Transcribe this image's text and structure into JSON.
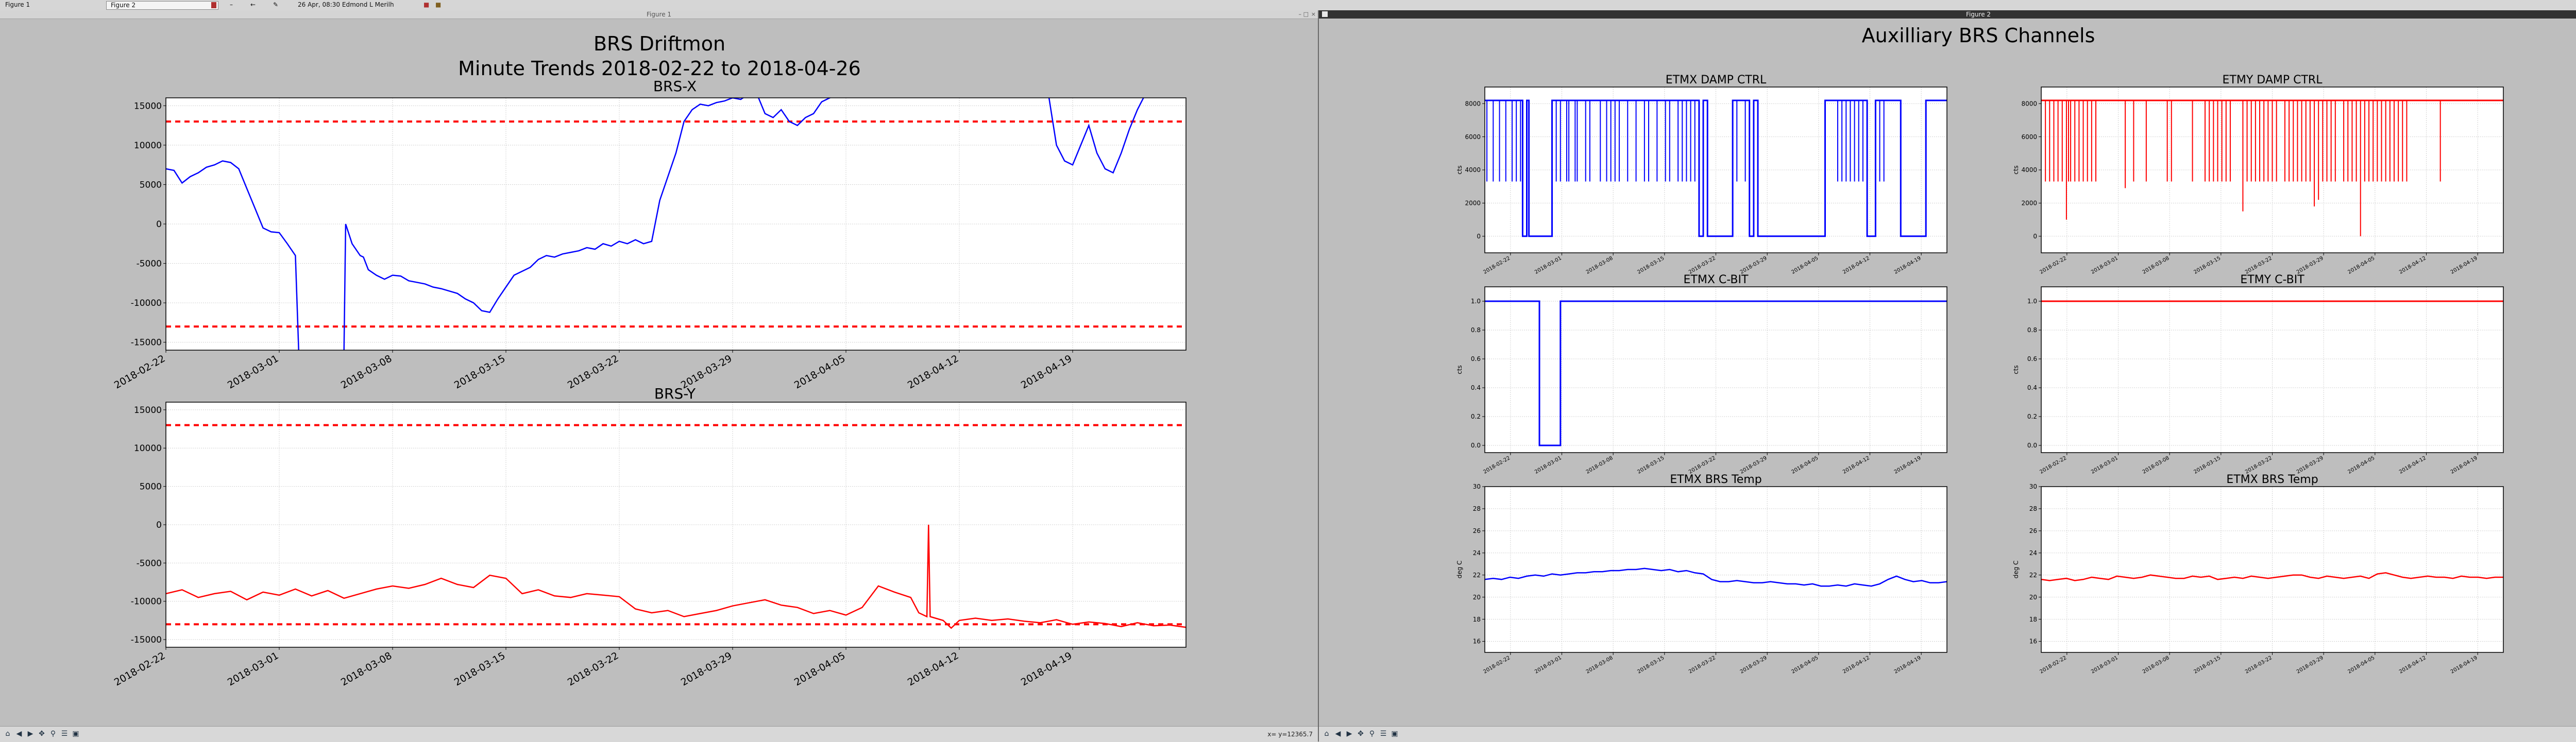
{
  "taskbar": {
    "window1_label": "Figure 1",
    "window2_label": "Figure 2",
    "clock_user": "26 Apr, 08:30  Edmond L Merilh"
  },
  "window1": {
    "title": "Figure 1",
    "suptitle_line1": "BRS Driftmon",
    "suptitle_line2": "Minute Trends 2018-02-22  to 2018-04-26",
    "coords_readout": "x=  y=12365.7"
  },
  "window2": {
    "title": "Figure 2",
    "suptitle": "Auxilliary BRS Channels"
  },
  "colors": {
    "blue": "#0000ff",
    "red": "#ff0000",
    "threshold": "#ff0000",
    "grid": "#d0d0d0"
  },
  "chart_data": [
    {
      "type": "line",
      "title": "BRS-X",
      "color": "#0000ff",
      "xlabel": "",
      "ylabel": "",
      "xlim": [
        0,
        63
      ],
      "ylim": [
        -16000,
        16000
      ],
      "xticks": [
        0,
        7,
        14,
        21,
        28,
        35,
        42,
        49,
        56
      ],
      "xticklabels": [
        "2018-02-22",
        "2018-03-01",
        "2018-03-08",
        "2018-03-15",
        "2018-03-22",
        "2018-03-29",
        "2018-04-05",
        "2018-04-12",
        "2018-04-19"
      ],
      "yticks": [
        -15000,
        -10000,
        -5000,
        0,
        5000,
        10000,
        15000
      ],
      "thresholds": [
        13000,
        -13000
      ],
      "segments": [
        [
          [
            0,
            7000
          ],
          [
            0.5,
            6800
          ],
          [
            1,
            5200
          ],
          [
            1.5,
            6000
          ],
          [
            2,
            6500
          ],
          [
            2.5,
            7200
          ],
          [
            3,
            7500
          ],
          [
            3.5,
            8000
          ],
          [
            4,
            7800
          ],
          [
            4.5,
            7000
          ],
          [
            5,
            4500
          ],
          [
            5.5,
            2000
          ],
          [
            6,
            -500
          ],
          [
            6.5,
            -1000
          ],
          [
            7,
            -1100
          ],
          [
            7.5,
            -2500
          ],
          [
            8,
            -4000
          ],
          [
            8.2,
            -16000
          ]
        ],
        [
          [
            11,
            -16000
          ],
          [
            11.1,
            0
          ],
          [
            11.5,
            -2500
          ],
          [
            12,
            -4000
          ],
          [
            12.2,
            -4200
          ],
          [
            12.5,
            -5800
          ],
          [
            13,
            -6500
          ],
          [
            13.5,
            -7000
          ],
          [
            14,
            -6500
          ],
          [
            14.5,
            -6600
          ],
          [
            15,
            -7200
          ],
          [
            15.5,
            -7400
          ],
          [
            16,
            -7600
          ],
          [
            16.5,
            -8000
          ],
          [
            17,
            -8200
          ],
          [
            17.5,
            -8500
          ],
          [
            18,
            -8800
          ],
          [
            18.5,
            -9500
          ],
          [
            19,
            -10000
          ],
          [
            19.5,
            -11000
          ],
          [
            20,
            -11200
          ],
          [
            20.5,
            -9500
          ],
          [
            21,
            -8000
          ],
          [
            21.5,
            -6500
          ],
          [
            22,
            -6000
          ],
          [
            22.5,
            -5500
          ],
          [
            23,
            -4500
          ],
          [
            23.5,
            -4000
          ],
          [
            24,
            -4200
          ],
          [
            24.5,
            -3800
          ],
          [
            25,
            -3600
          ],
          [
            25.5,
            -3400
          ],
          [
            26,
            -3000
          ],
          [
            26.5,
            -3200
          ],
          [
            27,
            -2500
          ],
          [
            27.5,
            -2800
          ],
          [
            28,
            -2200
          ],
          [
            28.5,
            -2500
          ],
          [
            29,
            -2000
          ],
          [
            29.5,
            -2500
          ],
          [
            30,
            -2200
          ],
          [
            30.5,
            3000
          ],
          [
            31,
            6000
          ],
          [
            31.5,
            9000
          ],
          [
            32,
            13000
          ],
          [
            32.5,
            14500
          ],
          [
            33,
            15200
          ],
          [
            33.5,
            15000
          ],
          [
            34,
            15400
          ],
          [
            34.5,
            15600
          ],
          [
            35,
            16000
          ],
          [
            35.5,
            15800
          ],
          [
            36,
            16500
          ]
        ],
        [
          [
            36.5,
            16500
          ],
          [
            37,
            14000
          ],
          [
            37.5,
            13500
          ],
          [
            38,
            14500
          ],
          [
            38.5,
            13000
          ],
          [
            39,
            12500
          ],
          [
            39.5,
            13500
          ],
          [
            40,
            14000
          ],
          [
            40.5,
            15500
          ],
          [
            41,
            16000
          ],
          [
            41.5,
            16500
          ]
        ],
        [
          [
            54.5,
            16500
          ],
          [
            55,
            10000
          ],
          [
            55.5,
            8000
          ],
          [
            56,
            7500
          ],
          [
            56.5,
            10000
          ],
          [
            57,
            12500
          ],
          [
            57.5,
            9000
          ],
          [
            58,
            7000
          ],
          [
            58.5,
            6500
          ],
          [
            59,
            9000
          ],
          [
            59.5,
            12000
          ],
          [
            60,
            14500
          ],
          [
            60.5,
            16500
          ]
        ]
      ]
    },
    {
      "type": "line",
      "title": "BRS-Y",
      "color": "#ff0000",
      "xlabel": "",
      "ylabel": "",
      "xlim": [
        0,
        63
      ],
      "ylim": [
        -16000,
        16000
      ],
      "xticks": [
        0,
        7,
        14,
        21,
        28,
        35,
        42,
        49,
        56
      ],
      "xticklabels": [
        "2018-02-22",
        "2018-03-01",
        "2018-03-08",
        "2018-03-15",
        "2018-03-22",
        "2018-03-29",
        "2018-04-05",
        "2018-04-12",
        "2018-04-19"
      ],
      "yticks": [
        -15000,
        -10000,
        -5000,
        0,
        5000,
        10000,
        15000
      ],
      "thresholds": [
        13000,
        -13000
      ],
      "segments": [
        [
          [
            0,
            -9000
          ],
          [
            1,
            -8500
          ],
          [
            2,
            -9500
          ],
          [
            3,
            -9000
          ],
          [
            4,
            -8700
          ],
          [
            5,
            -9800
          ],
          [
            6,
            -8800
          ],
          [
            7,
            -9200
          ],
          [
            8,
            -8400
          ],
          [
            9,
            -9300
          ],
          [
            10,
            -8600
          ],
          [
            11,
            -9600
          ],
          [
            12,
            -9000
          ],
          [
            13,
            -8400
          ],
          [
            14,
            -8000
          ],
          [
            15,
            -8300
          ],
          [
            16,
            -7800
          ],
          [
            17,
            -7000
          ],
          [
            18,
            -7800
          ],
          [
            19,
            -8200
          ],
          [
            20,
            -6600
          ],
          [
            21,
            -7000
          ],
          [
            21.5,
            -8000
          ],
          [
            22,
            -9000
          ],
          [
            23,
            -8500
          ],
          [
            24,
            -9300
          ],
          [
            25,
            -9500
          ],
          [
            26,
            -9000
          ],
          [
            27,
            -9200
          ],
          [
            28,
            -9400
          ],
          [
            29,
            -11000
          ],
          [
            30,
            -11500
          ],
          [
            31,
            -11200
          ],
          [
            32,
            -12000
          ],
          [
            33,
            -11600
          ],
          [
            34,
            -11200
          ],
          [
            35,
            -10600
          ],
          [
            36,
            -10200
          ],
          [
            37,
            -9800
          ],
          [
            38,
            -10500
          ],
          [
            39,
            -10800
          ],
          [
            40,
            -11600
          ],
          [
            41,
            -11200
          ],
          [
            42,
            -11800
          ],
          [
            43,
            -10800
          ],
          [
            44,
            -8000
          ],
          [
            45,
            -8800
          ],
          [
            46,
            -9500
          ],
          [
            46.5,
            -11500
          ],
          [
            47,
            -12000
          ],
          [
            47.1,
            0
          ],
          [
            47.2,
            -12000
          ],
          [
            48,
            -12500
          ],
          [
            48.5,
            -13500
          ],
          [
            49,
            -12500
          ],
          [
            50,
            -12200
          ],
          [
            51,
            -12500
          ],
          [
            52,
            -12300
          ],
          [
            53,
            -12600
          ],
          [
            54,
            -12800
          ],
          [
            55,
            -12400
          ],
          [
            56,
            -13000
          ],
          [
            57,
            -12700
          ],
          [
            58,
            -12900
          ],
          [
            59,
            -13300
          ],
          [
            60,
            -12800
          ],
          [
            61,
            -13200
          ],
          [
            62,
            -13100
          ],
          [
            63,
            -13400
          ]
        ]
      ]
    },
    {
      "type": "line",
      "title": "ETMX DAMP CTRL",
      "color": "#0000ff",
      "xlabel": "",
      "ylabel": "cts",
      "ylim": [
        -1000,
        9000
      ],
      "yticks": [
        0,
        2000,
        4000,
        6000,
        8000
      ],
      "xticklabels": [
        "2018-02-22",
        "2018-03-01",
        "2018-03-08",
        "2018-03-15",
        "2018-03-22",
        "2018-03-29",
        "2018-04-05",
        "2018-04-12",
        "2018-04-19"
      ],
      "kind": "digital",
      "on_value": 8192,
      "off_value": 0,
      "dip_value": 3300,
      "off_intervals": [
        [
          9,
          10
        ],
        [
          10.5,
          16
        ],
        [
          51,
          52
        ],
        [
          53,
          59
        ],
        [
          63,
          64
        ],
        [
          65,
          81
        ],
        [
          91,
          93
        ],
        [
          99,
          105
        ]
      ],
      "dips": [
        0.5,
        2,
        3.5,
        5,
        6.5,
        7.5,
        8.5,
        17,
        18,
        19.5,
        20,
        21.5,
        22,
        24,
        25,
        27.5,
        29,
        30,
        31,
        32,
        34,
        36,
        38,
        39,
        41,
        43,
        44,
        46,
        47,
        48,
        49,
        50,
        60,
        62,
        84,
        85,
        86,
        87,
        88,
        89,
        90,
        94,
        95
      ]
    },
    {
      "type": "line",
      "title": "ETMY DAMP CTRL",
      "color": "#ff0000",
      "xlabel": "",
      "ylabel": "cts",
      "ylim": [
        -1000,
        9000
      ],
      "yticks": [
        0,
        2000,
        4000,
        6000,
        8000
      ],
      "xticklabels": [
        "2018-02-22",
        "2018-03-01",
        "2018-03-08",
        "2018-03-15",
        "2018-03-22",
        "2018-03-29",
        "2018-04-05",
        "2018-04-12",
        "2018-04-19"
      ],
      "kind": "digital",
      "on_value": 8192,
      "off_value": 0,
      "dip_value": 3300,
      "off_intervals": [],
      "dips": [
        1,
        2,
        3,
        4,
        5,
        6,
        6.5,
        7,
        8,
        9,
        10,
        11,
        12,
        13,
        20,
        22,
        25,
        30,
        31,
        36,
        39,
        40,
        41,
        42,
        43,
        44,
        45,
        49,
        50,
        51,
        52,
        53,
        54,
        55,
        56,
        58,
        59,
        60,
        61,
        62,
        63,
        64,
        65,
        66,
        67,
        68,
        69,
        70,
        72,
        73,
        74,
        75,
        76,
        77,
        78,
        79,
        80,
        81,
        82,
        83,
        84,
        85,
        86,
        87,
        95
      ],
      "deep_dips": [
        [
          6,
          1000
        ],
        [
          20,
          2900
        ],
        [
          48,
          1500
        ],
        [
          65,
          1800
        ],
        [
          66,
          2200
        ],
        [
          76,
          0
        ]
      ]
    },
    {
      "type": "line",
      "title": "ETMX C-BIT",
      "color": "#0000ff",
      "xlabel": "",
      "ylabel": "cts",
      "ylim": [
        -0.05,
        1.1
      ],
      "yticks": [
        0.0,
        0.2,
        0.4,
        0.6,
        0.8,
        1.0
      ],
      "xticklabels": [
        "2018-02-22",
        "2018-03-01",
        "2018-03-08",
        "2018-03-15",
        "2018-03-22",
        "2018-03-29",
        "2018-04-05",
        "2018-04-12",
        "2018-04-19"
      ],
      "kind": "step",
      "low_interval": [
        13,
        18
      ]
    },
    {
      "type": "line",
      "title": "ETMY C-BIT",
      "color": "#ff0000",
      "xlabel": "",
      "ylabel": "cts",
      "ylim": [
        -0.05,
        1.1
      ],
      "yticks": [
        0.0,
        0.2,
        0.4,
        0.6,
        0.8,
        1.0
      ],
      "xticklabels": [
        "2018-02-22",
        "2018-03-01",
        "2018-03-08",
        "2018-03-15",
        "2018-03-22",
        "2018-03-29",
        "2018-04-05",
        "2018-04-12",
        "2018-04-19"
      ],
      "kind": "step",
      "low_interval": null
    },
    {
      "type": "line",
      "title": "ETMX BRS Temp",
      "color": "#0000ff",
      "xlabel": "",
      "ylabel": "deg C",
      "ylim": [
        15,
        30
      ],
      "yticks": [
        16,
        18,
        20,
        22,
        24,
        26,
        28,
        30
      ],
      "xticklabels": [
        "2018-02-22",
        "2018-03-01",
        "2018-03-08",
        "2018-03-15",
        "2018-03-22",
        "2018-03-29",
        "2018-04-05",
        "2018-04-12",
        "2018-04-19"
      ],
      "kind": "series",
      "values": [
        21.6,
        21.7,
        21.6,
        21.8,
        21.7,
        21.9,
        22.0,
        21.9,
        22.1,
        22.0,
        22.1,
        22.2,
        22.2,
        22.3,
        22.3,
        22.4,
        22.4,
        22.5,
        22.5,
        22.6,
        22.5,
        22.4,
        22.5,
        22.3,
        22.4,
        22.2,
        22.1,
        21.6,
        21.4,
        21.4,
        21.5,
        21.4,
        21.3,
        21.3,
        21.4,
        21.3,
        21.2,
        21.2,
        21.1,
        21.2,
        21.0,
        21.0,
        21.1,
        21.0,
        21.2,
        21.1,
        21.0,
        21.2,
        21.6,
        21.9,
        21.6,
        21.4,
        21.5,
        21.3,
        21.3,
        21.4
      ]
    },
    {
      "type": "line",
      "title": "ETMX BRS Temp",
      "color": "#ff0000",
      "xlabel": "",
      "ylabel": "deg C",
      "ylim": [
        15,
        30
      ],
      "yticks": [
        16,
        18,
        20,
        22,
        24,
        26,
        28,
        30
      ],
      "xticklabels": [
        "2018-02-22",
        "2018-03-01",
        "2018-03-08",
        "2018-03-15",
        "2018-03-22",
        "2018-03-29",
        "2018-04-05",
        "2018-04-12",
        "2018-04-19"
      ],
      "kind": "series",
      "values": [
        21.6,
        21.5,
        21.6,
        21.7,
        21.5,
        21.6,
        21.8,
        21.7,
        21.6,
        21.9,
        21.8,
        21.7,
        21.8,
        22.0,
        21.9,
        21.8,
        21.7,
        21.7,
        21.9,
        21.8,
        21.9,
        21.6,
        21.7,
        21.8,
        21.7,
        21.9,
        21.8,
        21.7,
        21.8,
        21.9,
        22.0,
        22.0,
        21.8,
        21.7,
        21.9,
        21.8,
        21.7,
        21.8,
        21.9,
        21.7,
        22.1,
        22.2,
        22.0,
        21.8,
        21.7,
        21.8,
        21.9,
        21.8,
        21.8,
        21.7,
        21.9,
        21.8,
        21.8,
        21.7,
        21.8,
        21.8
      ]
    }
  ]
}
